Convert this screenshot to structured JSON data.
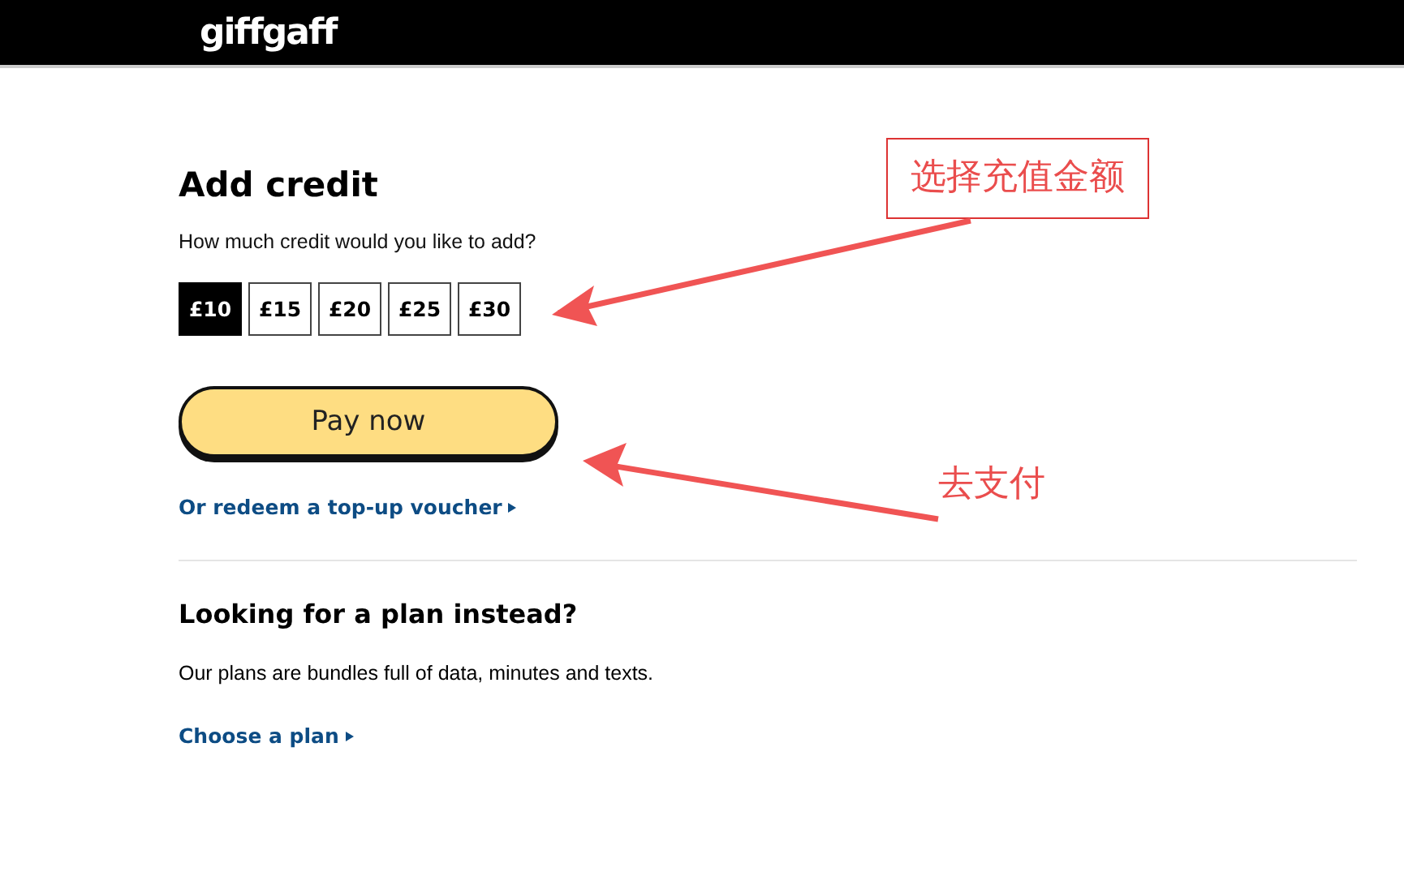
{
  "header": {
    "logo": "giffgaff"
  },
  "credit": {
    "title": "Add credit",
    "question": "How much credit would you like to add?",
    "amounts": [
      {
        "label": "£10",
        "selected": true
      },
      {
        "label": "£15",
        "selected": false
      },
      {
        "label": "£20",
        "selected": false
      },
      {
        "label": "£25",
        "selected": false
      },
      {
        "label": "£30",
        "selected": false
      }
    ],
    "pay_button": "Pay now",
    "voucher_link": "Or redeem a top-up voucher"
  },
  "plan": {
    "title": "Looking for a plan instead?",
    "text": "Our plans are bundles full of data, minutes and texts.",
    "link": "Choose a plan"
  },
  "annotations": [
    {
      "text": "选择充值金额",
      "kind": "boxed"
    },
    {
      "text": "去支付",
      "kind": "plain"
    }
  ]
}
